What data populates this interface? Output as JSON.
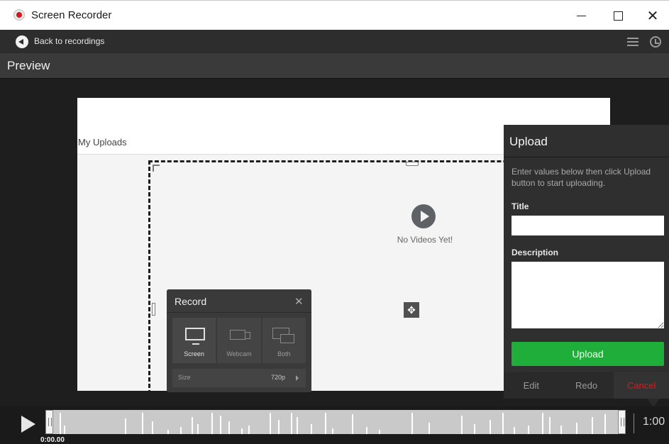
{
  "window": {
    "title": "Screen Recorder",
    "minimize_glyph": "—",
    "close_glyph": "✕"
  },
  "toolbar": {
    "back_label": "Back to recordings",
    "icons": [
      "list-icon",
      "history-icon"
    ]
  },
  "preview": {
    "header": "Preview",
    "page_heading": "My Uploads",
    "empty_message": "No Videos Yet!",
    "move_glyph": "✥"
  },
  "record_panel": {
    "title": "Record",
    "close_glyph": "✕",
    "options": [
      {
        "label": "Screen",
        "active": true
      },
      {
        "label": "Webcam",
        "active": false
      },
      {
        "label": "Both",
        "active": false
      }
    ],
    "size_label": "Size",
    "size_value": "720p"
  },
  "upload_panel": {
    "title": "Upload",
    "instructions": "Enter values below then click Upload button to start uploading.",
    "title_label": "Title",
    "title_value": "",
    "description_label": "Description",
    "description_value": "",
    "upload_button": "Upload",
    "footer": {
      "edit": "Edit",
      "redo": "Redo",
      "cancel": "Cancel"
    },
    "colors": {
      "upload_button": "#1fae3a",
      "cancel_text": "#e01717"
    }
  },
  "timeline": {
    "duration": "1:00",
    "start_time": "0:00.00"
  }
}
